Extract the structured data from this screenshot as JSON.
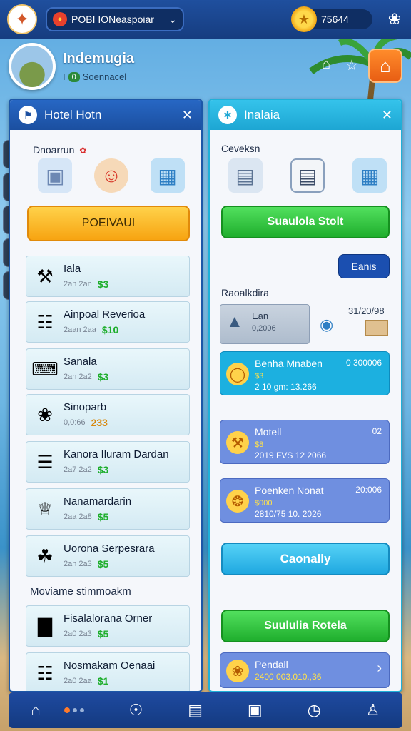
{
  "topbar": {
    "server_name": "POBI IONeaspoiar",
    "coins": "75644"
  },
  "profile": {
    "name": "Indemugia",
    "level": "0",
    "subtitle": "Soennacel"
  },
  "left_panel": {
    "title": "Hotel Hotn",
    "section_label": "Dnoarrun",
    "primary_button": "POEIVAUI",
    "list_section_label": "Moviame stimmoakm",
    "items": [
      {
        "title": "Iala",
        "meta": "2an 2an",
        "value": "$3",
        "icon": "drink-icon"
      },
      {
        "title": "Ainpoal Reverioa",
        "meta": "2aan 2aa",
        "value": "$10",
        "icon": "document-icon"
      },
      {
        "title": "Sanala",
        "meta": "2an 2a2",
        "value": "$3",
        "icon": "laptop-icon"
      },
      {
        "title": "Sinoparb",
        "meta": "0,0:66",
        "value": "233",
        "icon": "bird-icon"
      },
      {
        "title": "Kanora Iluram Dardan",
        "meta": "2a7 2a2",
        "value": "$3",
        "icon": "book-icon"
      },
      {
        "title": "Nanamardarin",
        "meta": "2aa 2a8",
        "value": "$5",
        "icon": "trophy-icon"
      },
      {
        "title": "Uorona Serpesrara",
        "meta": "2an 2a3",
        "value": "$5",
        "icon": "plant-icon"
      },
      {
        "title": "Fisalalorana Orner",
        "meta": "2a0 2a3",
        "value": "$5",
        "icon": "chair-icon"
      },
      {
        "title": "Nosmakam Oenaai",
        "meta": "2a0 2aa",
        "value": "$1",
        "icon": "globe-doc-icon"
      }
    ]
  },
  "right_panel": {
    "title": "Inalaia",
    "section_label": "Ceveksn",
    "green_button_1": "Suaulola Stolt",
    "small_button": "Eanis",
    "section_label_2": "Raoalkdira",
    "card_grey": {
      "title": "Ean",
      "sub": "0,2006"
    },
    "card_grey_date": "31/20/98",
    "cards": [
      {
        "title": "Benha Mnaben",
        "right": "0 300006",
        "yellow": "$3",
        "detail": "2 10 gm: 13.266",
        "icon": "ring-icon",
        "color": "#1cb0e0"
      },
      {
        "title": "Motell",
        "right": "02",
        "yellow": "$8",
        "detail": "2019 FVS 12 2066",
        "icon": "tool-icon",
        "color": "#6f8fe0"
      },
      {
        "title": "Poenken Nonat",
        "right": "20:006",
        "yellow": "$000",
        "detail": "2810/75 10. 2026",
        "icon": "shell-icon",
        "color": "#6f8fe0"
      },
      {
        "title": "Pendall",
        "right": "",
        "yellow": "",
        "detail": "2400 003.010.,36",
        "icon": "food-icon",
        "color": "#6f8fe0"
      }
    ],
    "blue_button": "Caonally",
    "green_button_2": "Suululia Rotela"
  },
  "colors": {
    "header_blue": "#1b4fa0",
    "accent_cyan": "#1da6d3",
    "green": "#1fae2d",
    "orange": "#f7a411"
  }
}
